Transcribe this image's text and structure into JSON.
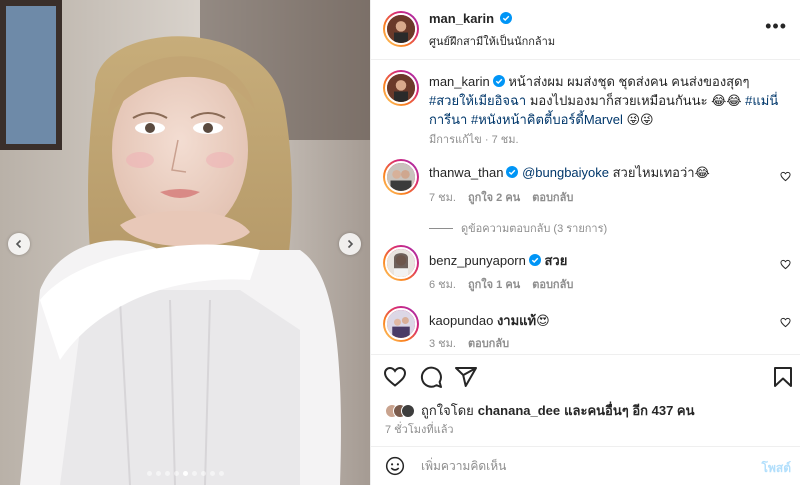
{
  "post": {
    "author": "man_karin",
    "location": "ศูนย์ฝึกสามีให้เป็นนักกล้าม",
    "caption_main": "หน้าส่งผม ผมส่งชุด ชุดส่งคน คนส่งของสุดๆ ",
    "caption_tag1": "#สวยให้เมียอิจฉา",
    "caption_mid": " มองไปมองมาก็สวยเหมือนกันนะ 😂😂 ",
    "caption_tag2": "#แม่นี่การีนา",
    "caption_tag3": "#หนังหน้าคิตตี้บอร์ดี้Marvel",
    "caption_end": " 😜😜",
    "edited": "มีการแก้ไข · 7 ชม.",
    "carousel_total": 9,
    "carousel_active": 5
  },
  "comments": [
    {
      "user": "thanwa_than",
      "verified": true,
      "mention": "@bungbaiyoke",
      "text": " สวยไหมเทอว่า😂",
      "time": "7 ชม.",
      "likes": "ถูกใจ 2 คน",
      "reply": "ตอบกลับ",
      "view_replies": "ดูข้อความตอบกลับ (3 รายการ)"
    },
    {
      "user": "benz_punyaporn",
      "verified": true,
      "mention": "",
      "text": " สวย",
      "time": "6 ชม.",
      "likes": "ถูกใจ 1 คน",
      "reply": "ตอบกลับ"
    },
    {
      "user": "kaopundao",
      "verified": false,
      "mention": "",
      "text": " งามแท้😍",
      "time": "3 ชม.",
      "likes": "",
      "reply": "ตอบกลับ"
    }
  ],
  "likes_line": {
    "prefix": "ถูกใจโดย ",
    "user": "chanana_dee",
    "suffix": " และคนอื่นๆ อีก 437 คน"
  },
  "posted_ago": "7 ชั่วโมงที่แล้ว",
  "add_comment": {
    "placeholder": "เพิ่มความคิดเห็น",
    "post_label": "โพสต์"
  },
  "icons": {
    "more": "more-horizontal-icon",
    "like": "heart-icon",
    "comment": "comment-icon",
    "share": "send-icon",
    "save": "bookmark-icon",
    "emoji": "emoji-icon",
    "verified": "verified-badge-icon"
  },
  "colors": {
    "link": "#00376b",
    "verified": "#0095f6",
    "muted": "#8e8e8e",
    "post_disabled": "#b2dffc"
  }
}
